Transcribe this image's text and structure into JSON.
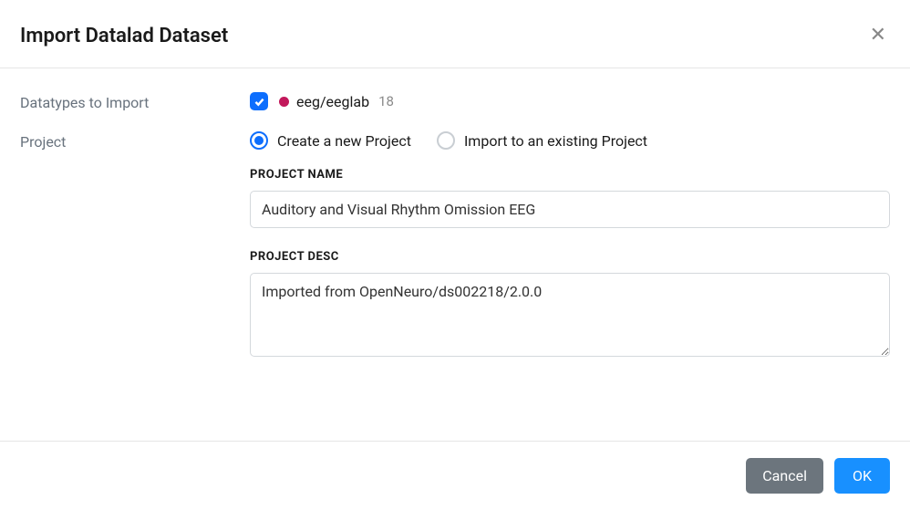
{
  "header": {
    "title": "Import Datalad Dataset"
  },
  "datatypes": {
    "label": "Datatypes to Import",
    "items": [
      {
        "checked": true,
        "dot_color": "#c2185b",
        "name": "eeg/eeglab",
        "count": "18"
      }
    ]
  },
  "project": {
    "label": "Project",
    "options": {
      "create": {
        "label": "Create a new Project",
        "selected": true
      },
      "existing": {
        "label": "Import to an existing Project",
        "selected": false
      }
    },
    "name_label": "Project Name",
    "name_value": "Auditory and Visual Rhythm Omission EEG",
    "desc_label": "Project Desc",
    "desc_value": "Imported from OpenNeuro/ds002218/2.0.0"
  },
  "footer": {
    "cancel": "Cancel",
    "ok": "OK"
  }
}
